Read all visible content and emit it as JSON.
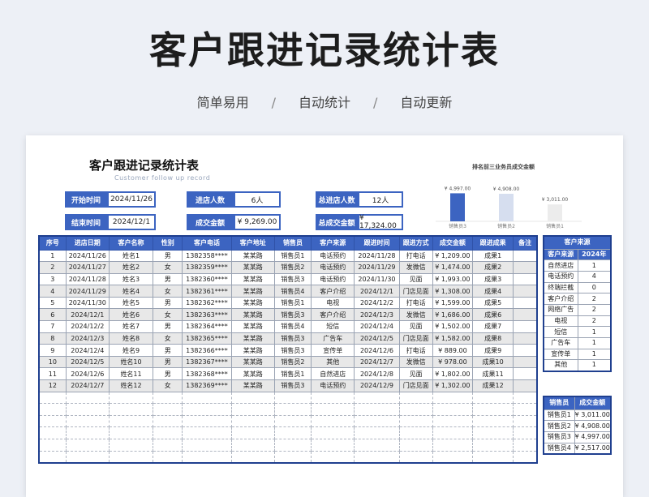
{
  "hero": {
    "title": "客户跟进记录统计表",
    "tags": [
      "简单易用",
      "自动统计",
      "自动更新"
    ],
    "separator": "/"
  },
  "sheet": {
    "title": "客户跟进记录统计表",
    "subtitle": "Customer follow up record"
  },
  "summary": {
    "start_label": "开始时间",
    "start_value": "2024/11/26",
    "end_label": "结束时间",
    "end_value": "2024/12/1",
    "visits_label": "进店人数",
    "visits_value": "6人",
    "amount_label": "成交金额",
    "amount_value": "¥ 9,269.00",
    "total_visits_label": "总进店人数",
    "total_visits_value": "12人",
    "total_amount_label": "总成交金额",
    "total_amount_value": "¥ 17,324.00"
  },
  "chart_data": {
    "type": "bar",
    "title": "排名前三业务员成交金额",
    "categories": [
      "销售员3",
      "销售员2",
      "销售员1"
    ],
    "values": [
      4997,
      4908,
      3011
    ],
    "value_labels": [
      "¥ 4,997.00",
      "¥ 4,908.00",
      "¥ 3,011.00"
    ],
    "colors": [
      "#3c64c1",
      "#d6deef",
      "#ececec"
    ],
    "ylim": [
      0,
      5200
    ]
  },
  "table": {
    "headers": [
      "序号",
      "进店日期",
      "客户名称",
      "性别",
      "客户电话",
      "客户地址",
      "销售员",
      "客户来源",
      "跟进时间",
      "跟进方式",
      "成交金额",
      "跟进成果",
      "备注"
    ],
    "rows": [
      [
        "1",
        "2024/11/26",
        "姓名1",
        "男",
        "1382358****",
        "某某路",
        "销售员1",
        "电话预约",
        "2024/11/28",
        "打电话",
        "¥ 1,209.00",
        "成果1",
        ""
      ],
      [
        "2",
        "2024/11/27",
        "姓名2",
        "女",
        "1382359****",
        "某某路",
        "销售员2",
        "电话预约",
        "2024/11/29",
        "发微信",
        "¥ 1,474.00",
        "成果2",
        ""
      ],
      [
        "3",
        "2024/11/28",
        "姓名3",
        "男",
        "1382360****",
        "某某路",
        "销售员3",
        "电话预约",
        "2024/11/30",
        "见面",
        "¥ 1,993.00",
        "成果3",
        ""
      ],
      [
        "4",
        "2024/11/29",
        "姓名4",
        "女",
        "1382361****",
        "某某路",
        "销售员4",
        "客户介绍",
        "2024/12/1",
        "门店见面",
        "¥ 1,308.00",
        "成果4",
        ""
      ],
      [
        "5",
        "2024/11/30",
        "姓名5",
        "男",
        "1382362****",
        "某某路",
        "销售员1",
        "电视",
        "2024/12/2",
        "打电话",
        "¥ 1,599.00",
        "成果5",
        ""
      ],
      [
        "6",
        "2024/12/1",
        "姓名6",
        "女",
        "1382363****",
        "某某路",
        "销售员3",
        "客户介绍",
        "2024/12/3",
        "发微信",
        "¥ 1,686.00",
        "成果6",
        ""
      ],
      [
        "7",
        "2024/12/2",
        "姓名7",
        "男",
        "1382364****",
        "某某路",
        "销售员4",
        "短信",
        "2024/12/4",
        "见面",
        "¥ 1,502.00",
        "成果7",
        ""
      ],
      [
        "8",
        "2024/12/3",
        "姓名8",
        "女",
        "1382365****",
        "某某路",
        "销售员3",
        "广告车",
        "2024/12/5",
        "门店见面",
        "¥ 1,582.00",
        "成果8",
        ""
      ],
      [
        "9",
        "2024/12/4",
        "姓名9",
        "男",
        "1382366****",
        "某某路",
        "销售员3",
        "宣传单",
        "2024/12/6",
        "打电话",
        "¥ 889.00",
        "成果9",
        ""
      ],
      [
        "10",
        "2024/12/5",
        "姓名10",
        "男",
        "1382367****",
        "某某路",
        "销售员2",
        "其他",
        "2024/12/7",
        "发微信",
        "¥ 978.00",
        "成果10",
        ""
      ],
      [
        "11",
        "2024/12/6",
        "姓名11",
        "男",
        "1382368****",
        "某某路",
        "销售员1",
        "自然进店",
        "2024/12/8",
        "见面",
        "¥ 1,802.00",
        "成果11",
        ""
      ],
      [
        "12",
        "2024/12/7",
        "姓名12",
        "女",
        "1382369****",
        "某某路",
        "销售员3",
        "电话预约",
        "2024/12/9",
        "门店见面",
        "¥ 1,302.00",
        "成果12",
        ""
      ]
    ]
  },
  "source_table": {
    "title": "客户来源",
    "col_source": "客户来源",
    "col_year": "2024年",
    "rows": [
      [
        "自然进店",
        "1"
      ],
      [
        "电话预约",
        "4"
      ],
      [
        "终端拦截",
        "0"
      ],
      [
        "客户介绍",
        "2"
      ],
      [
        "网络广告",
        "2"
      ],
      [
        "电视",
        "2"
      ],
      [
        "短信",
        "1"
      ],
      [
        "广告车",
        "1"
      ],
      [
        "宣传单",
        "1"
      ],
      [
        "其他",
        "1"
      ]
    ]
  },
  "sales_table": {
    "col_sales": "销售员",
    "col_amount": "成交金额",
    "rows": [
      [
        "销售员1",
        "¥ 3,011.00"
      ],
      [
        "销售员2",
        "¥ 4,908.00"
      ],
      [
        "销售员3",
        "¥ 4,997.00"
      ],
      [
        "销售员4",
        "¥ 2,517.00"
      ]
    ]
  }
}
